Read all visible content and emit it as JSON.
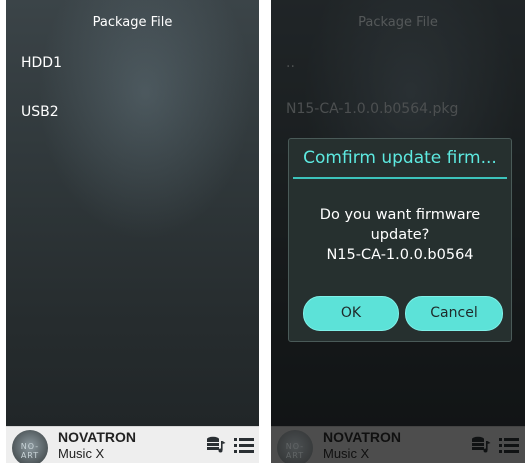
{
  "left_screen": {
    "title": "Package File",
    "items": [
      {
        "label": "HDD1"
      },
      {
        "label": "USB2"
      }
    ]
  },
  "right_screen": {
    "title": "Package File",
    "items": [
      {
        "label": ".."
      },
      {
        "label": "N15-CA-1.0.0.b0564.pkg"
      }
    ],
    "dialog": {
      "title": "Comfirm update firm...",
      "message_line1": "Do you want firmware",
      "message_line2": "update?",
      "message_line3": "N15-CA-1.0.0.b0564",
      "ok_label": "OK",
      "cancel_label": "Cancel"
    }
  },
  "footer": {
    "brand": "NOVATRON",
    "subtitle": "Music X",
    "album_art_label": "NO-ART",
    "icons": [
      "database-music-icon",
      "menu-list-icon"
    ]
  },
  "colors": {
    "accent": "#5de9e0",
    "button": "#5ce2d8",
    "footer_bg": "#eeeeee"
  }
}
